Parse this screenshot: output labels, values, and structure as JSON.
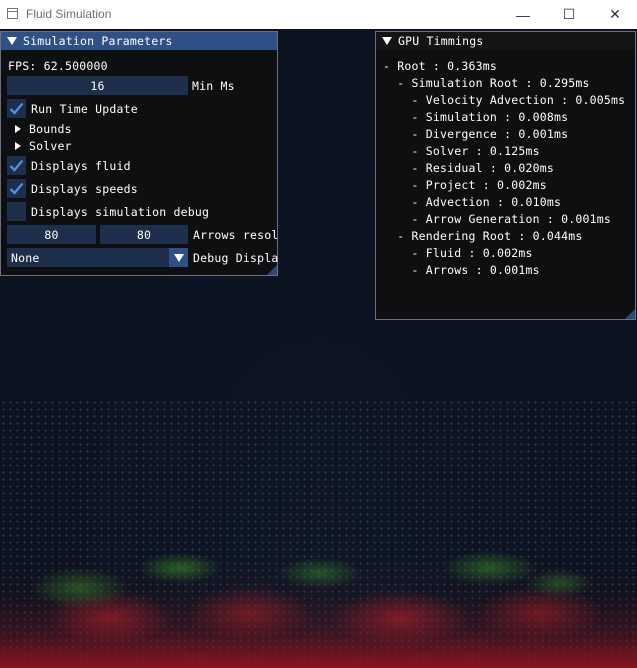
{
  "window": {
    "title": "Fluid Simulation",
    "minimize_glyph": "—",
    "maximize_glyph": "☐",
    "close_glyph": "✕"
  },
  "sim_params": {
    "title": "Simulation Parameters",
    "fps_line": "FPS: 62.500000",
    "min_ms_value": "16",
    "min_ms_label": "Min Ms",
    "run_time_update": {
      "label": "Run Time Update",
      "checked": true
    },
    "bounds_label": "Bounds",
    "solver_label": "Solver",
    "displays_fluid": {
      "label": "Displays fluid",
      "checked": true
    },
    "displays_speeds": {
      "label": "Displays speeds",
      "checked": true
    },
    "displays_debug": {
      "label": "Displays simulation debug",
      "checked": false
    },
    "arrows_res_x": "80",
    "arrows_res_y": "80",
    "arrows_res_label": "Arrows resol",
    "debug_display_value": "None",
    "debug_display_label": "Debug Displa"
  },
  "gpu_timings": {
    "title": "GPU Timmings",
    "lines": [
      "- Root : 0.363ms",
      "  - Simulation Root : 0.295ms",
      "    - Velocity Advection : 0.005ms",
      "    - Simulation : 0.008ms",
      "    - Divergence : 0.001ms",
      "    - Solver : 0.125ms",
      "    - Residual : 0.020ms",
      "    - Project : 0.002ms",
      "    - Advection : 0.010ms",
      "    - Arrow Generation : 0.001ms",
      "  - Rendering Root : 0.044ms",
      "    - Fluid : 0.002ms",
      "    - Arrows : 0.001ms"
    ]
  },
  "colors": {
    "header_active": "#2e5288",
    "frame_bg": "#1d2f4a",
    "check_mark": "#4a8fe0",
    "fluid_red": "#a01e28",
    "fluid_green": "#3c8c28"
  }
}
